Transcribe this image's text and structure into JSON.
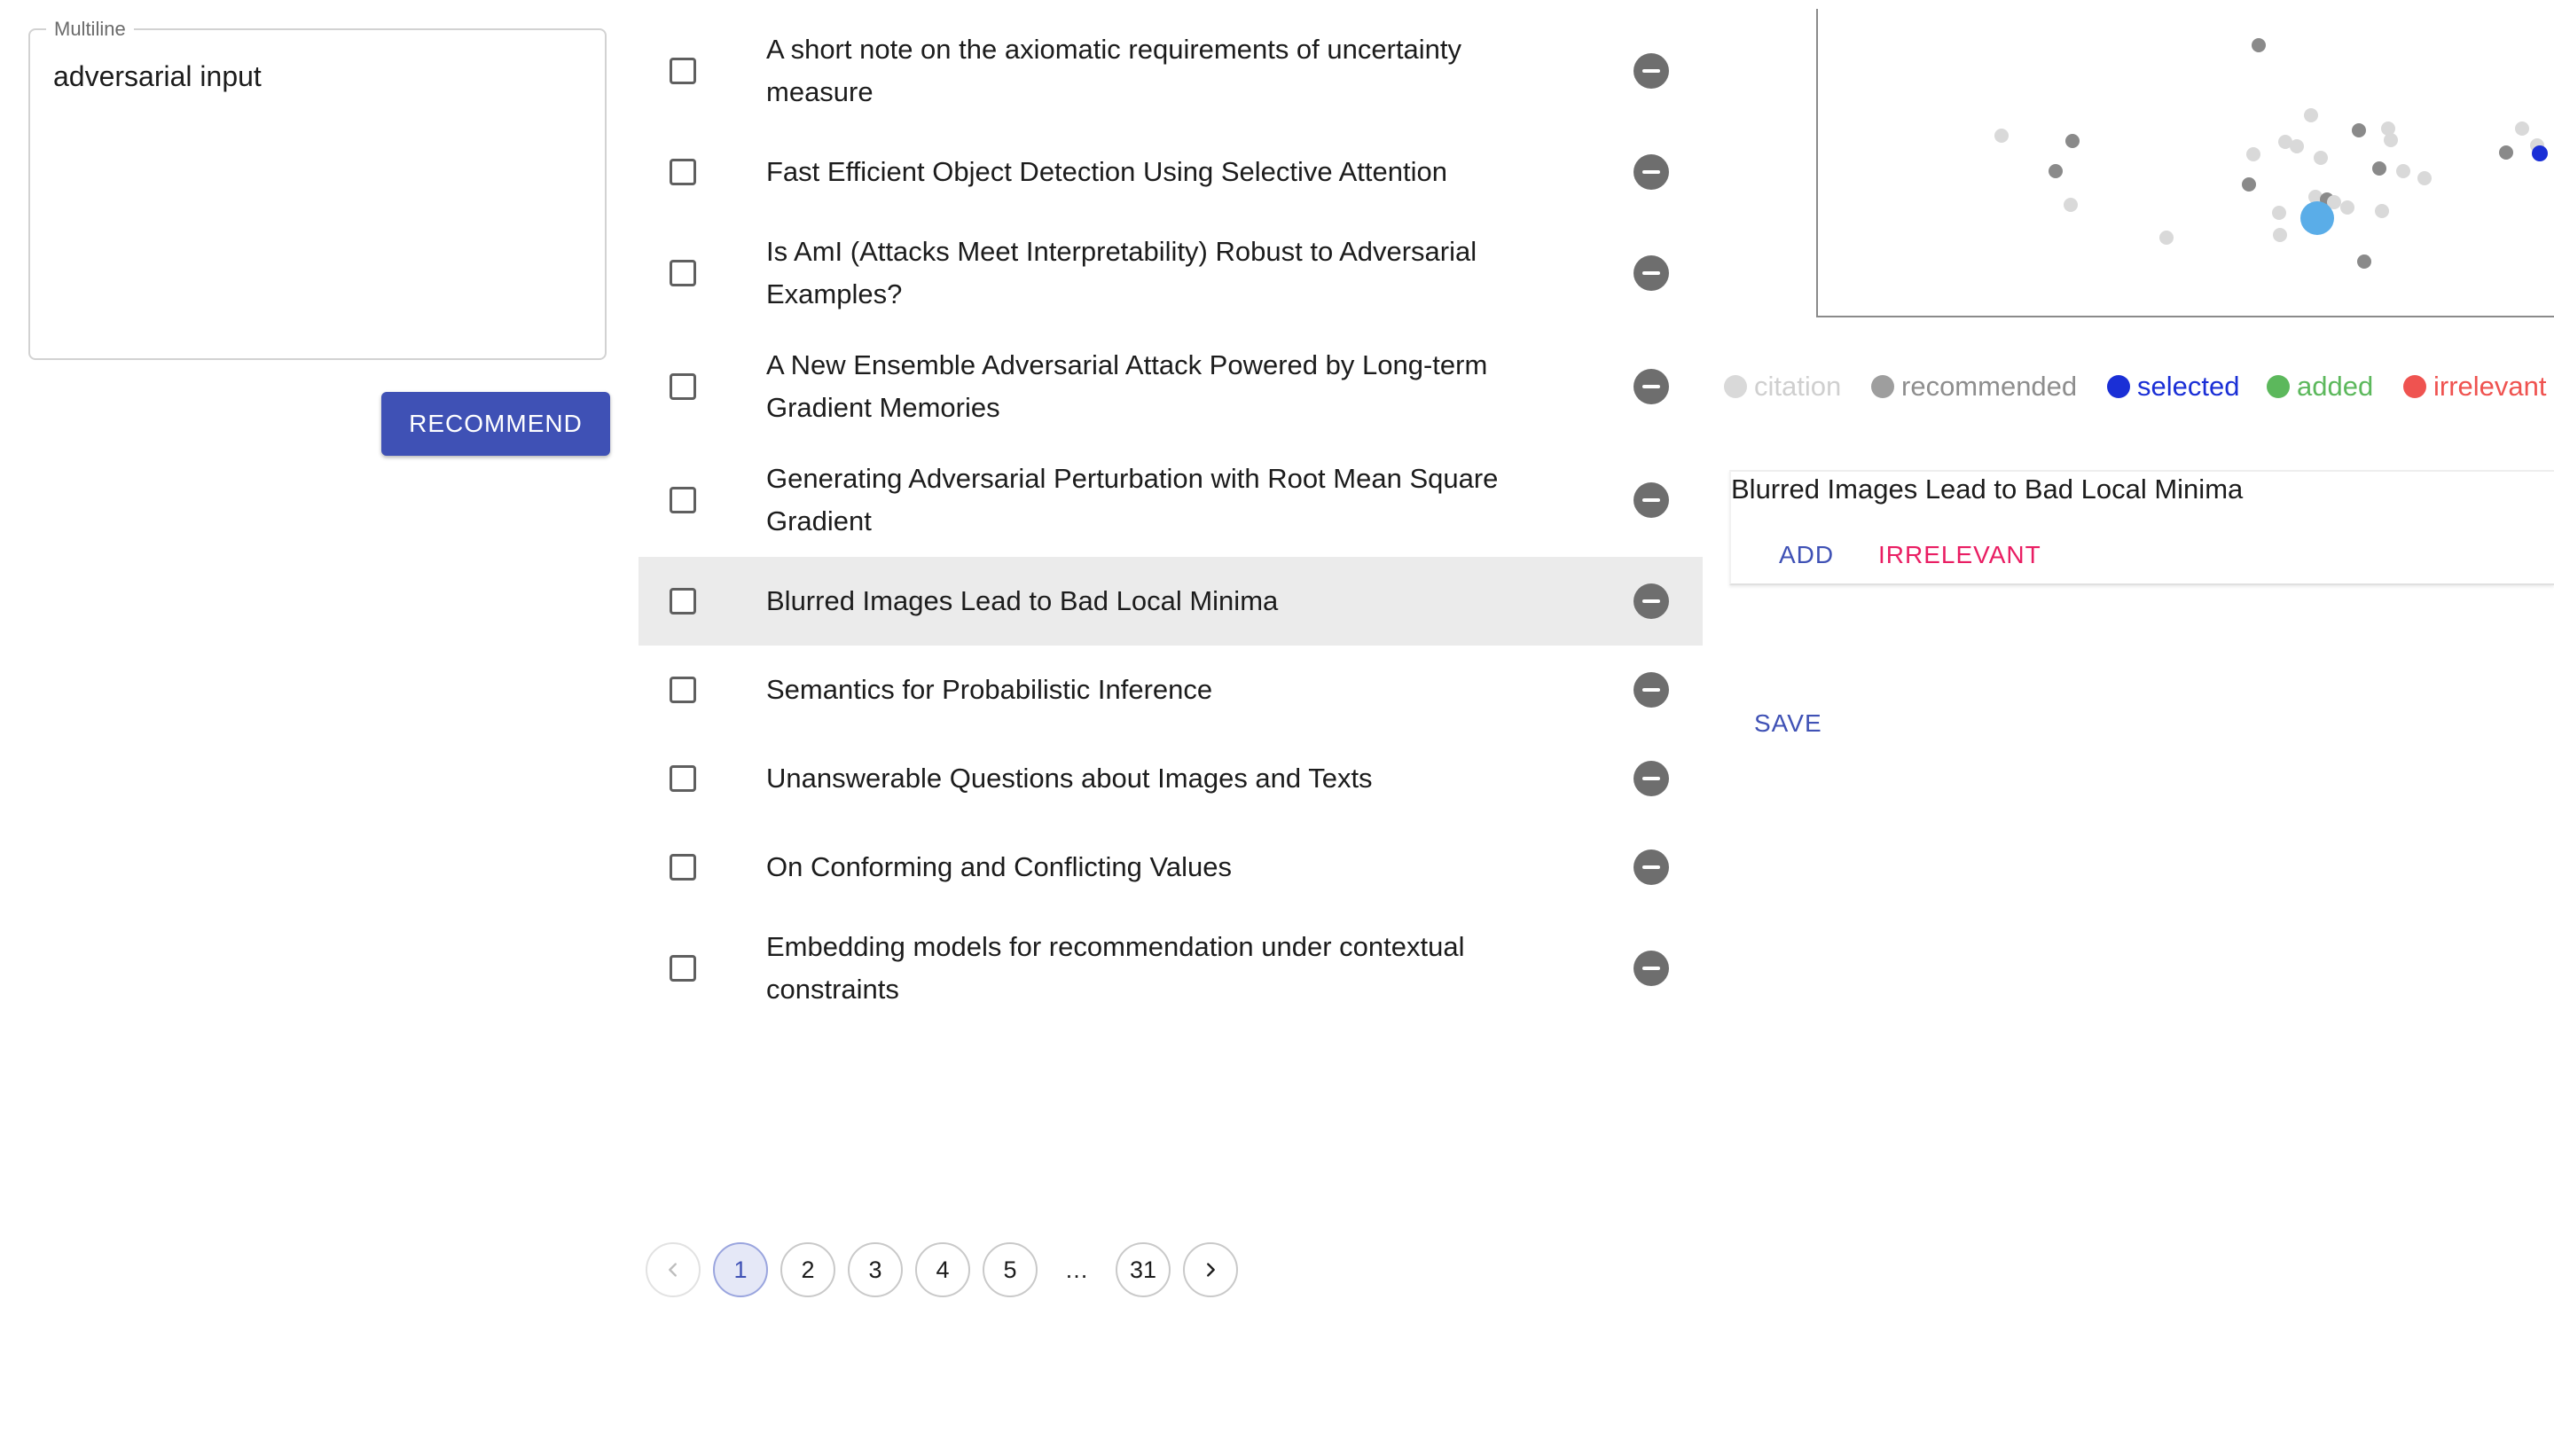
{
  "query": {
    "label": "Multiline",
    "value": "adversarial input"
  },
  "recommend_label": "RECOMMEND",
  "papers": [
    {
      "title": "A short note on the axiomatic requirements of uncertainty measure",
      "checked": false,
      "selected": false
    },
    {
      "title": "Fast Efficient Object Detection Using Selective Attention",
      "checked": false,
      "selected": false
    },
    {
      "title": "Is AmI (Attacks Meet Interpretability) Robust to Adversarial Examples?",
      "checked": false,
      "selected": false
    },
    {
      "title": "A New Ensemble Adversarial Attack Powered by Long-term Gradient Memories",
      "checked": false,
      "selected": false
    },
    {
      "title": "Generating Adversarial Perturbation with Root Mean Square Gradient",
      "checked": false,
      "selected": false
    },
    {
      "title": "Blurred Images Lead to Bad Local Minima",
      "checked": false,
      "selected": true
    },
    {
      "title": "Semantics for Probabilistic Inference",
      "checked": false,
      "selected": false
    },
    {
      "title": "Unanswerable Questions about Images and Texts",
      "checked": false,
      "selected": false
    },
    {
      "title": "On Conforming and Conflicting Values",
      "checked": false,
      "selected": false
    },
    {
      "title": "Embedding models for recommendation under contextual constraints",
      "checked": false,
      "selected": false
    }
  ],
  "pagination": {
    "prev_icon": "chevron-left-icon",
    "next_icon": "chevron-right-icon",
    "pages": [
      "1",
      "2",
      "3",
      "4",
      "5"
    ],
    "ellipsis": "…",
    "last_page": "31",
    "current": "1"
  },
  "legend": [
    {
      "label": "citation",
      "color": "#d9d9d9"
    },
    {
      "label": "recommended",
      "color": "#9e9e9e"
    },
    {
      "label": "selected",
      "color": "#1a2fd6"
    },
    {
      "label": "added",
      "color": "#5cb85c"
    },
    {
      "label": "irrelevant",
      "color": "#ef5350"
    }
  ],
  "detail": {
    "title": "Blurred Images Lead to Bad Local Minima",
    "add_label": "ADD",
    "irrelevant_label": "IRRELEVANT"
  },
  "save_label": "SAVE",
  "colors": {
    "accent": "#3f51b5",
    "danger": "#e91e63",
    "focus_point": "#5aade8"
  }
}
